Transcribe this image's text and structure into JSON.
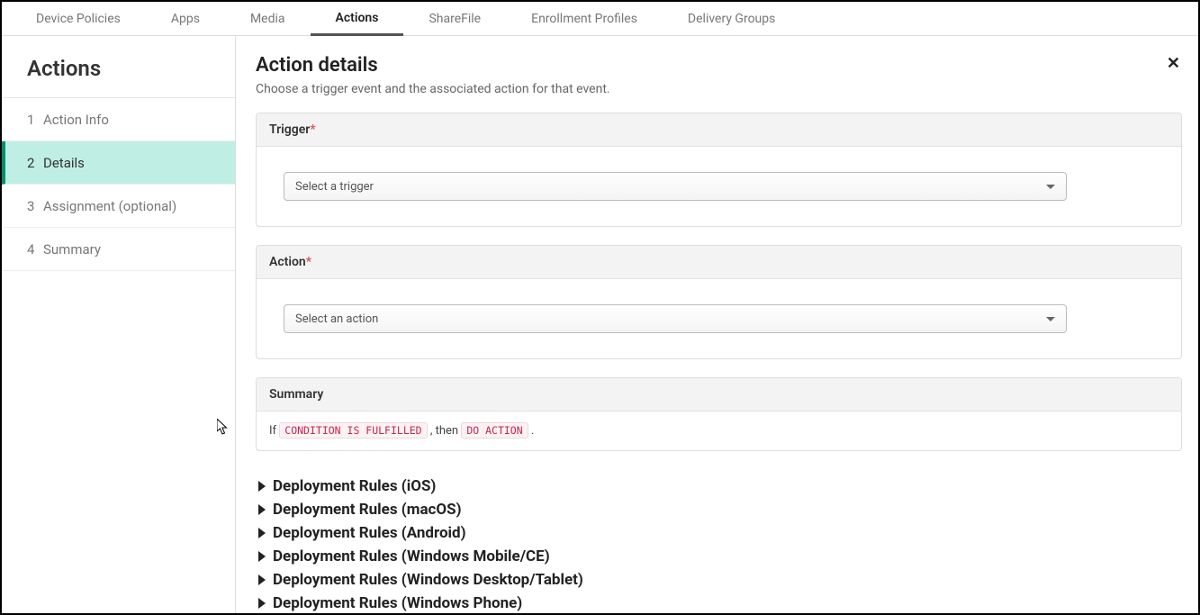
{
  "tabs": [
    "Device Policies",
    "Apps",
    "Media",
    "Actions",
    "ShareFile",
    "Enrollment Profiles",
    "Delivery Groups"
  ],
  "active_tab_index": 3,
  "sidebar": {
    "title": "Actions",
    "steps": [
      {
        "num": "1",
        "label": "Action Info"
      },
      {
        "num": "2",
        "label": "Details"
      },
      {
        "num": "3",
        "label": "Assignment (optional)"
      },
      {
        "num": "4",
        "label": "Summary"
      }
    ],
    "active_step_index": 1
  },
  "main": {
    "title": "Action details",
    "subtitle": "Choose a trigger event and the associated action for that event.",
    "close_label": "✕"
  },
  "panels": {
    "trigger": {
      "header": "Trigger",
      "required_marker": "*",
      "placeholder": "Select a trigger"
    },
    "action": {
      "header": "Action",
      "required_marker": "*",
      "placeholder": "Select an action"
    },
    "summary": {
      "header": "Summary",
      "prefix": "If ",
      "condition_code": "CONDITION IS FULFILLED",
      "middle": " , then ",
      "action_code": "DO ACTION",
      "suffix": " ."
    }
  },
  "deployment_rules": [
    "Deployment Rules (iOS)",
    "Deployment Rules (macOS)",
    "Deployment Rules (Android)",
    "Deployment Rules (Windows Mobile/CE)",
    "Deployment Rules (Windows Desktop/Tablet)",
    "Deployment Rules (Windows Phone)"
  ]
}
